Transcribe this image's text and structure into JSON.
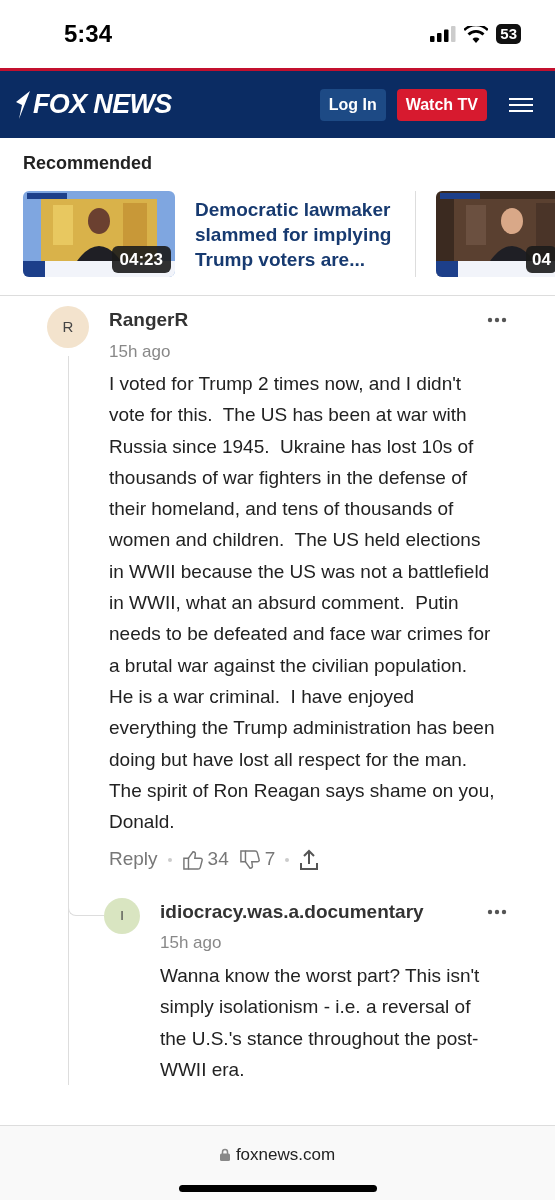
{
  "status_bar": {
    "time": "5:34",
    "battery": "53"
  },
  "header": {
    "logo": "FOX NEWS",
    "login": "Log In",
    "watch": "Watch TV"
  },
  "recommended": {
    "title": "Recommended",
    "items": [
      {
        "duration": "04:23",
        "headline": "Democratic lawmaker slammed for implying Trump voters are..."
      },
      {
        "duration": "04"
      }
    ]
  },
  "comments": [
    {
      "initial": "R",
      "color": "#f3e3cd",
      "author": "RangerR",
      "time": "15h ago",
      "body": "I voted for Trump 2 times now, and I didn't vote for this.  The US has been at war with Russia since 1945.  Ukraine has lost 10s of thousands of war fighters in the defense of their homeland, and tens of thousands of women and children.  The US held elections in WWII because the US was not a battlefield in WWII, what an absurd comment.  Putin needs to be defeated and face war crimes for a brutal war against the civilian population.  He is a war criminal.  I have enjoyed everything the Trump administration has been doing but have lost all respect for the man.  The spirit of Ron Reagan says shame on you, Donald.",
      "reply": "Reply",
      "likes": "34",
      "dislikes": "7",
      "replies": [
        {
          "initial": "I",
          "color": "#d9e5c1",
          "author": "idiocracy.was.a.documentary",
          "time": "15h ago",
          "body": "Wanna know the worst part? This isn't simply isolationism - i.e. a reversal of the U.S.'s stance throughout the post-WWII era."
        }
      ]
    }
  ],
  "browser_bar": {
    "url": "foxnews.com"
  }
}
